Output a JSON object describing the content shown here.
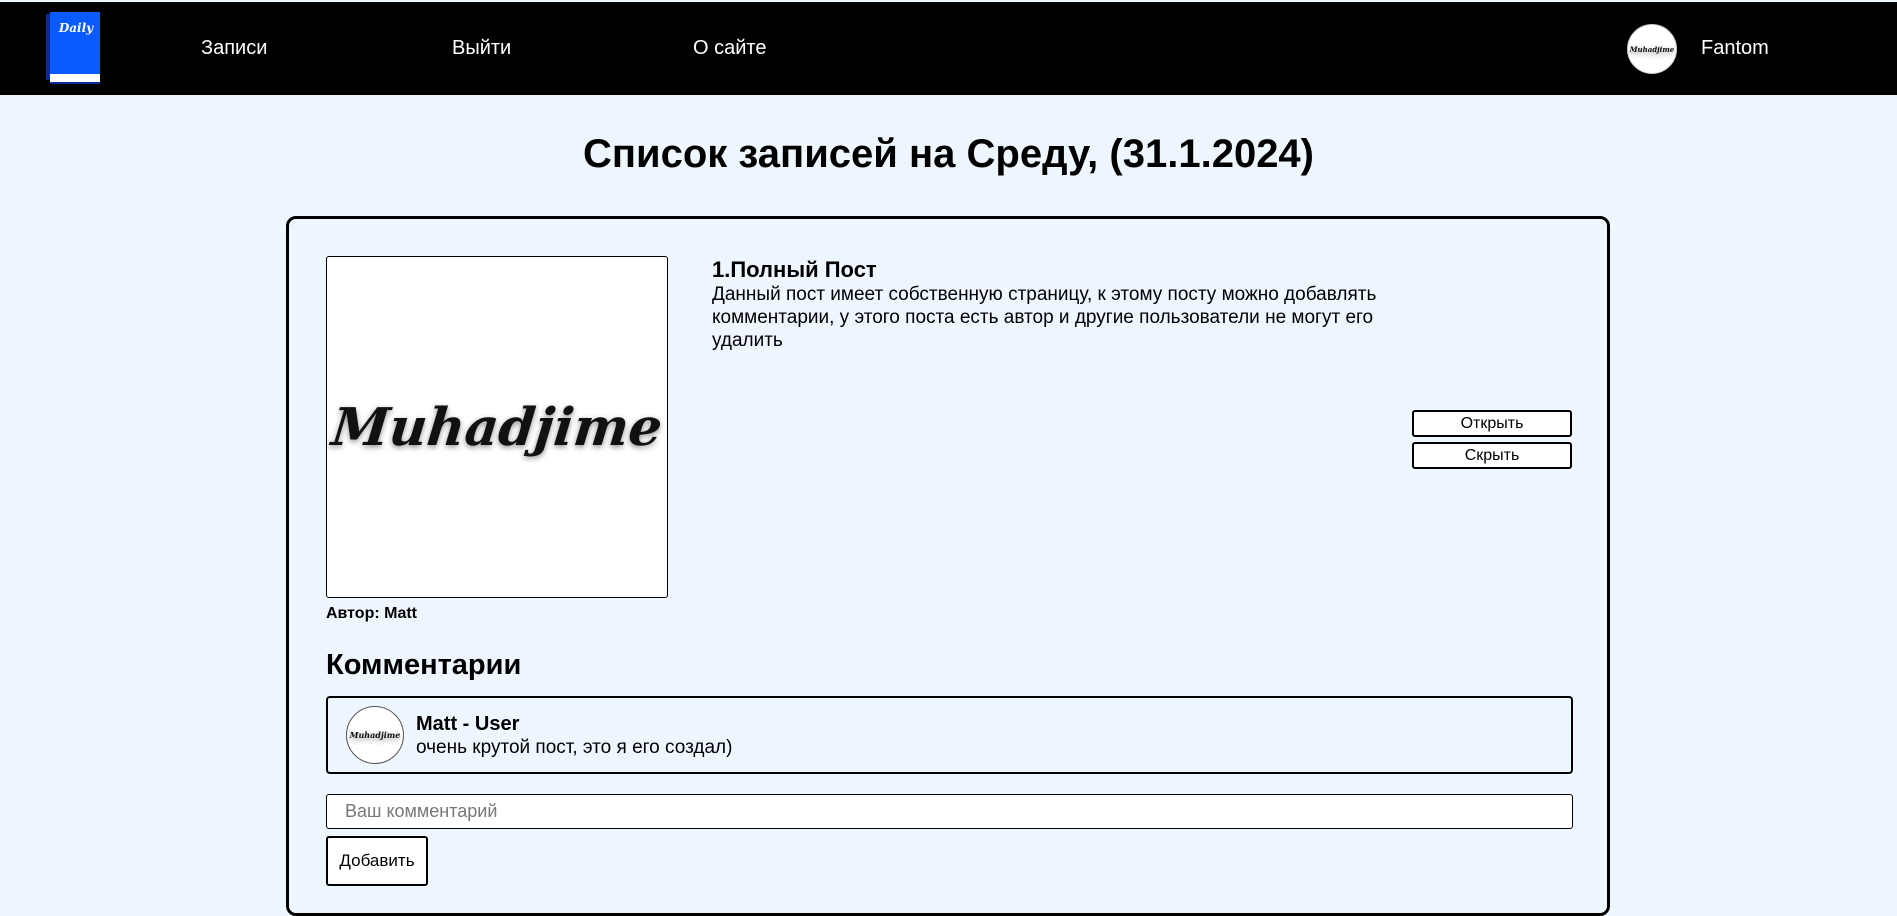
{
  "header": {
    "logo_text": "Daily",
    "nav": [
      {
        "label": "Записи"
      },
      {
        "label": "Выйти"
      },
      {
        "label": "О сайте"
      }
    ],
    "user": {
      "name": "Fantom",
      "avatar_text": "Muhadjime"
    }
  },
  "page": {
    "title": "Список записей на Среду, (31.1.2024)"
  },
  "post": {
    "title": "1.Полный Пост",
    "description": "Данный пост имеет собственную страницу, к этому посту можно добавлять комментарии, у этого поста есть автор и другие пользователи не могут его удалить",
    "image_text": "Muhadjime",
    "author": "Автор: Matt",
    "open_label": "Открыть",
    "hide_label": "Скрыть"
  },
  "comments": {
    "heading": "Комментарии",
    "items": [
      {
        "author": "Matt - User",
        "text": "очень крутой пост, это я его создал)",
        "avatar_text": "Muhadjime"
      }
    ],
    "input_placeholder": "Ваш комментарий",
    "add_label": "Добавить"
  },
  "colors": {
    "background": "#eef6ff",
    "header": "#000000",
    "logo_blue": "#0a5bff"
  }
}
